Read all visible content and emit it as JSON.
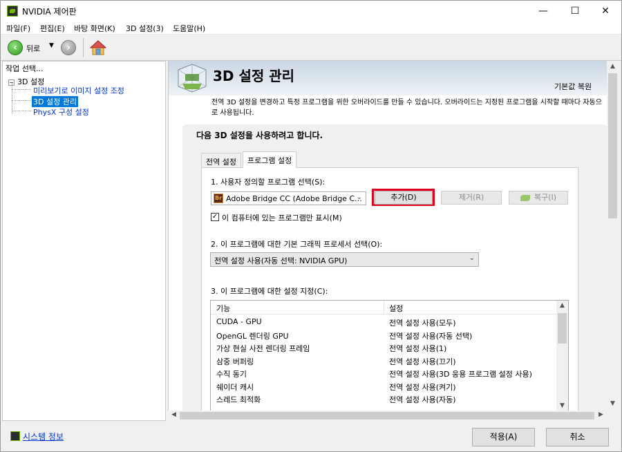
{
  "window": {
    "title": "NVIDIA 제어판",
    "minimize": "—",
    "maximize": "☐",
    "close": "✕"
  },
  "menu": [
    "파일(F)",
    "편집(E)",
    "바탕 화면(K)",
    "3D 설정(3)",
    "도움말(H)"
  ],
  "toolbar": {
    "back_label": "뒤로",
    "back_icon": "arrow-left-icon",
    "forward_icon": "arrow-right-icon",
    "home_icon": "home-icon"
  },
  "tree": {
    "header": "작업 선택...",
    "root": "3D 설정",
    "children": [
      "미리보기로 이미지 설정 조정",
      "3D 설정 관리",
      "PhysX 구성 설정"
    ],
    "selected_index": 1
  },
  "page": {
    "title": "3D 설정 관리",
    "restore": "기본값 복원",
    "description": "전역 3D 설정을 변경하고 특정 프로그램을 위한 오버라이드를 만들 수 있습니다. 오버라이드는 지정된 프로그램을 시작할 때마다 자동으로 사용됩니다.",
    "section_title": "다음 3D 설정을 사용하려고 합니다."
  },
  "tabs": [
    "전역 설정",
    "프로그램 설정"
  ],
  "active_tab_index": 1,
  "program": {
    "step1_label": "1. 사용자 정의할 프로그램 선택(S):",
    "selected_program": "Adobe Bridge CC (Adobe Bridge C...",
    "program_icon_text": "Br",
    "add_button": "추가(D)",
    "remove_button": "제거(R)",
    "restore_button": "복구(I)",
    "checkbox_checked": true,
    "checkbox_label": "이 컴퓨터에 있는 프로그램만 표시(M)"
  },
  "processor": {
    "step2_label": "2. 이 프로그램에 대한 기본 그래픽 프로세서 선택(O):",
    "selected": "전역 설정 사용(자동 선택: NVIDIA GPU)"
  },
  "settings": {
    "step3_label": "3. 이 프로그램에 대한 설정 지정(C):",
    "columns": [
      "기능",
      "설정"
    ],
    "rows": [
      [
        "CUDA - GPU",
        "전역 설정 사용(모두)"
      ],
      [
        "OpenGL 렌더링 GPU",
        "전역 설정 사용(자동 선택)"
      ],
      [
        "가상 현실 사전 렌더링 프레임",
        "전역 설정 사용(1)"
      ],
      [
        "삼중 버퍼링",
        "전역 설정 사용(끄기)"
      ],
      [
        "수직 동기",
        "전역 설정 사용(3D 응용 프로그램 설정 사용)"
      ],
      [
        "쉐이더 캐시",
        "전역 설정 사용(켜기)"
      ],
      [
        "스레드 최적화",
        "전역 설정 사용(자동)"
      ]
    ]
  },
  "bottom": {
    "system_info": "시스템 정보",
    "apply": "적용(A)",
    "cancel": "취소"
  },
  "colors": {
    "accent_selected": "#0078d7",
    "highlight_border": "#e3001b",
    "nvidia_green": "#76b900",
    "link": "#0033cc"
  }
}
